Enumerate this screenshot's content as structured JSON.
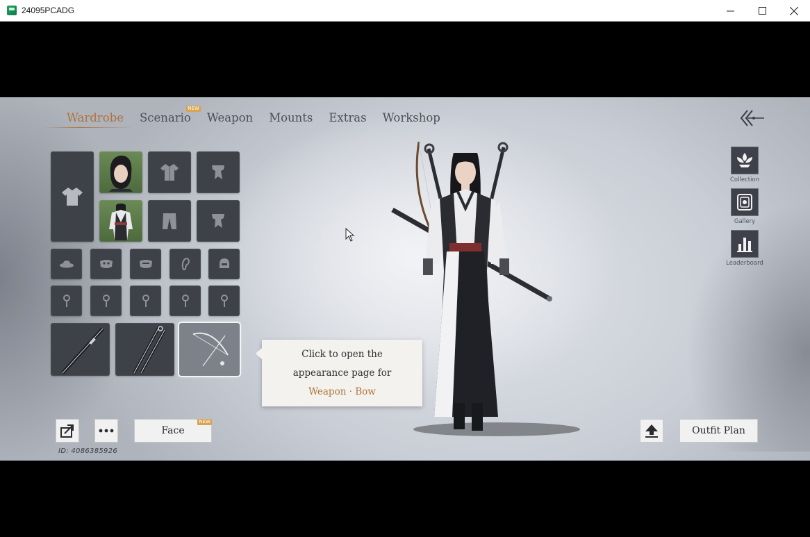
{
  "window": {
    "title": "24095PCADG",
    "minimize": "—",
    "maximize": "☐",
    "close": "✕"
  },
  "tabs": [
    {
      "label": "Wardrobe",
      "active": true
    },
    {
      "label": "Scenario",
      "badge": "NEW"
    },
    {
      "label": "Weapon"
    },
    {
      "label": "Mounts"
    },
    {
      "label": "Extras"
    },
    {
      "label": "Workshop"
    }
  ],
  "side_buttons": [
    {
      "label": "Collection",
      "icon": "lotus-icon"
    },
    {
      "label": "Gallery",
      "icon": "gallery-icon"
    },
    {
      "label": "Leaderboard",
      "icon": "bar-chart-icon"
    }
  ],
  "tooltip": {
    "line1": "Click to open the",
    "line2": "appearance page for",
    "line3": "Weapon · Bow"
  },
  "bottom": {
    "face_label": "Face",
    "face_badge": "NEW",
    "outfit_plan_label": "Outfit Plan",
    "id_text": "ID: 4086385926"
  },
  "colors": {
    "accent": "#b0743b",
    "slot_dark": "#3e4148",
    "badge": "#d6a453"
  }
}
